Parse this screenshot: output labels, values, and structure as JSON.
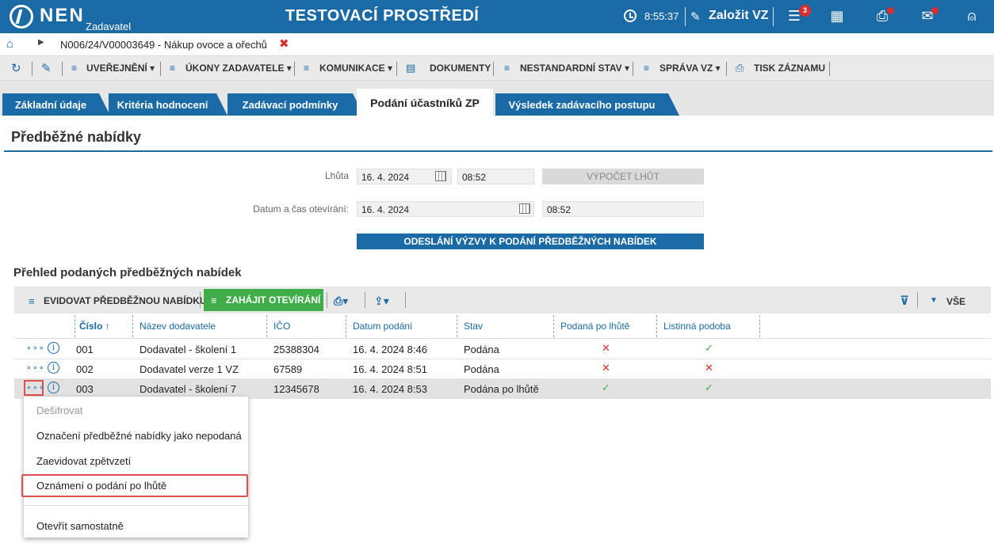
{
  "header": {
    "logo": "NEN",
    "logo_sub": "Zadavatel",
    "title": "TESTOVACÍ PROSTŘEDÍ",
    "time": "8:55:37",
    "create_label": "Založit VZ",
    "notif_count": "3"
  },
  "breadcrumb": {
    "text": "N006/24/V00003649 - Nákup ovoce a ořechů"
  },
  "toolbar": {
    "items": [
      "UVEŘEJNĚNÍ",
      "ÚKONY ZADAVATELE",
      "KOMUNIKACE",
      "DOKUMENTY",
      "NESTANDARDNÍ STAV",
      "SPRÁVA VZ",
      "TISK ZÁZNAMU"
    ]
  },
  "tabs": [
    "Základní údaje",
    "Kritéria hodnocení",
    "Zadávací podmínky",
    "Podání účastníků ZP",
    "Výsledek zadávacího postupu"
  ],
  "section": {
    "title": "Předběžné nabídky",
    "lhuta_label": "Lhůta",
    "lhuta_date": "16. 4. 2024",
    "lhuta_time": "08:52",
    "vypocet_label": "VÝPOČET LHŮT",
    "otevirani_label": "Datum a čas otevírání:",
    "otevirani_date": "16. 4. 2024",
    "otevirani_time": "08:52",
    "send_label": "ODESLÁNÍ VÝZVY K PODÁNÍ PŘEDBĚŽNÝCH NABÍDEK"
  },
  "overview": {
    "title": "Přehled podaných předběžných nabídek",
    "evidovat_label": "EVIDOVAT PŘEDBĚŽNOU NABÍDKU",
    "zahajit_label": "ZAHÁJIT OTEVÍRÁNÍ",
    "filter_all": "VŠE",
    "columns": [
      "Číslo",
      "Název dodavatele",
      "IČO",
      "Datum podání",
      "Stav",
      "Podaná po lhůtě",
      "Listinná podoba"
    ],
    "rows": [
      {
        "cislo": "001",
        "nazev": "Dodavatel - školení 1",
        "ico": "25388304",
        "datum": "16. 4. 2024 8:46",
        "stav": "Podána",
        "po_lhute": "no",
        "listinna": "yes"
      },
      {
        "cislo": "002",
        "nazev": "Dodavatel verze 1 VZ",
        "ico": "67589",
        "datum": "16. 4. 2024 8:51",
        "stav": "Podána",
        "po_lhute": "no",
        "listinna": "no"
      },
      {
        "cislo": "003",
        "nazev": "Dodavatel - školení 7",
        "ico": "12345678",
        "datum": "16. 4. 2024 8:53",
        "stav": "Podána po lhůtě",
        "po_lhute": "yes",
        "listinna": "yes"
      }
    ]
  },
  "context_menu": {
    "items": [
      "Dešifrovat",
      "Označení předběžné nabídky jako nepodaná",
      "Zaevidovat zpětvzetí",
      "Oznámení o podání po lhůtě",
      "Otevřít samostatně"
    ]
  }
}
